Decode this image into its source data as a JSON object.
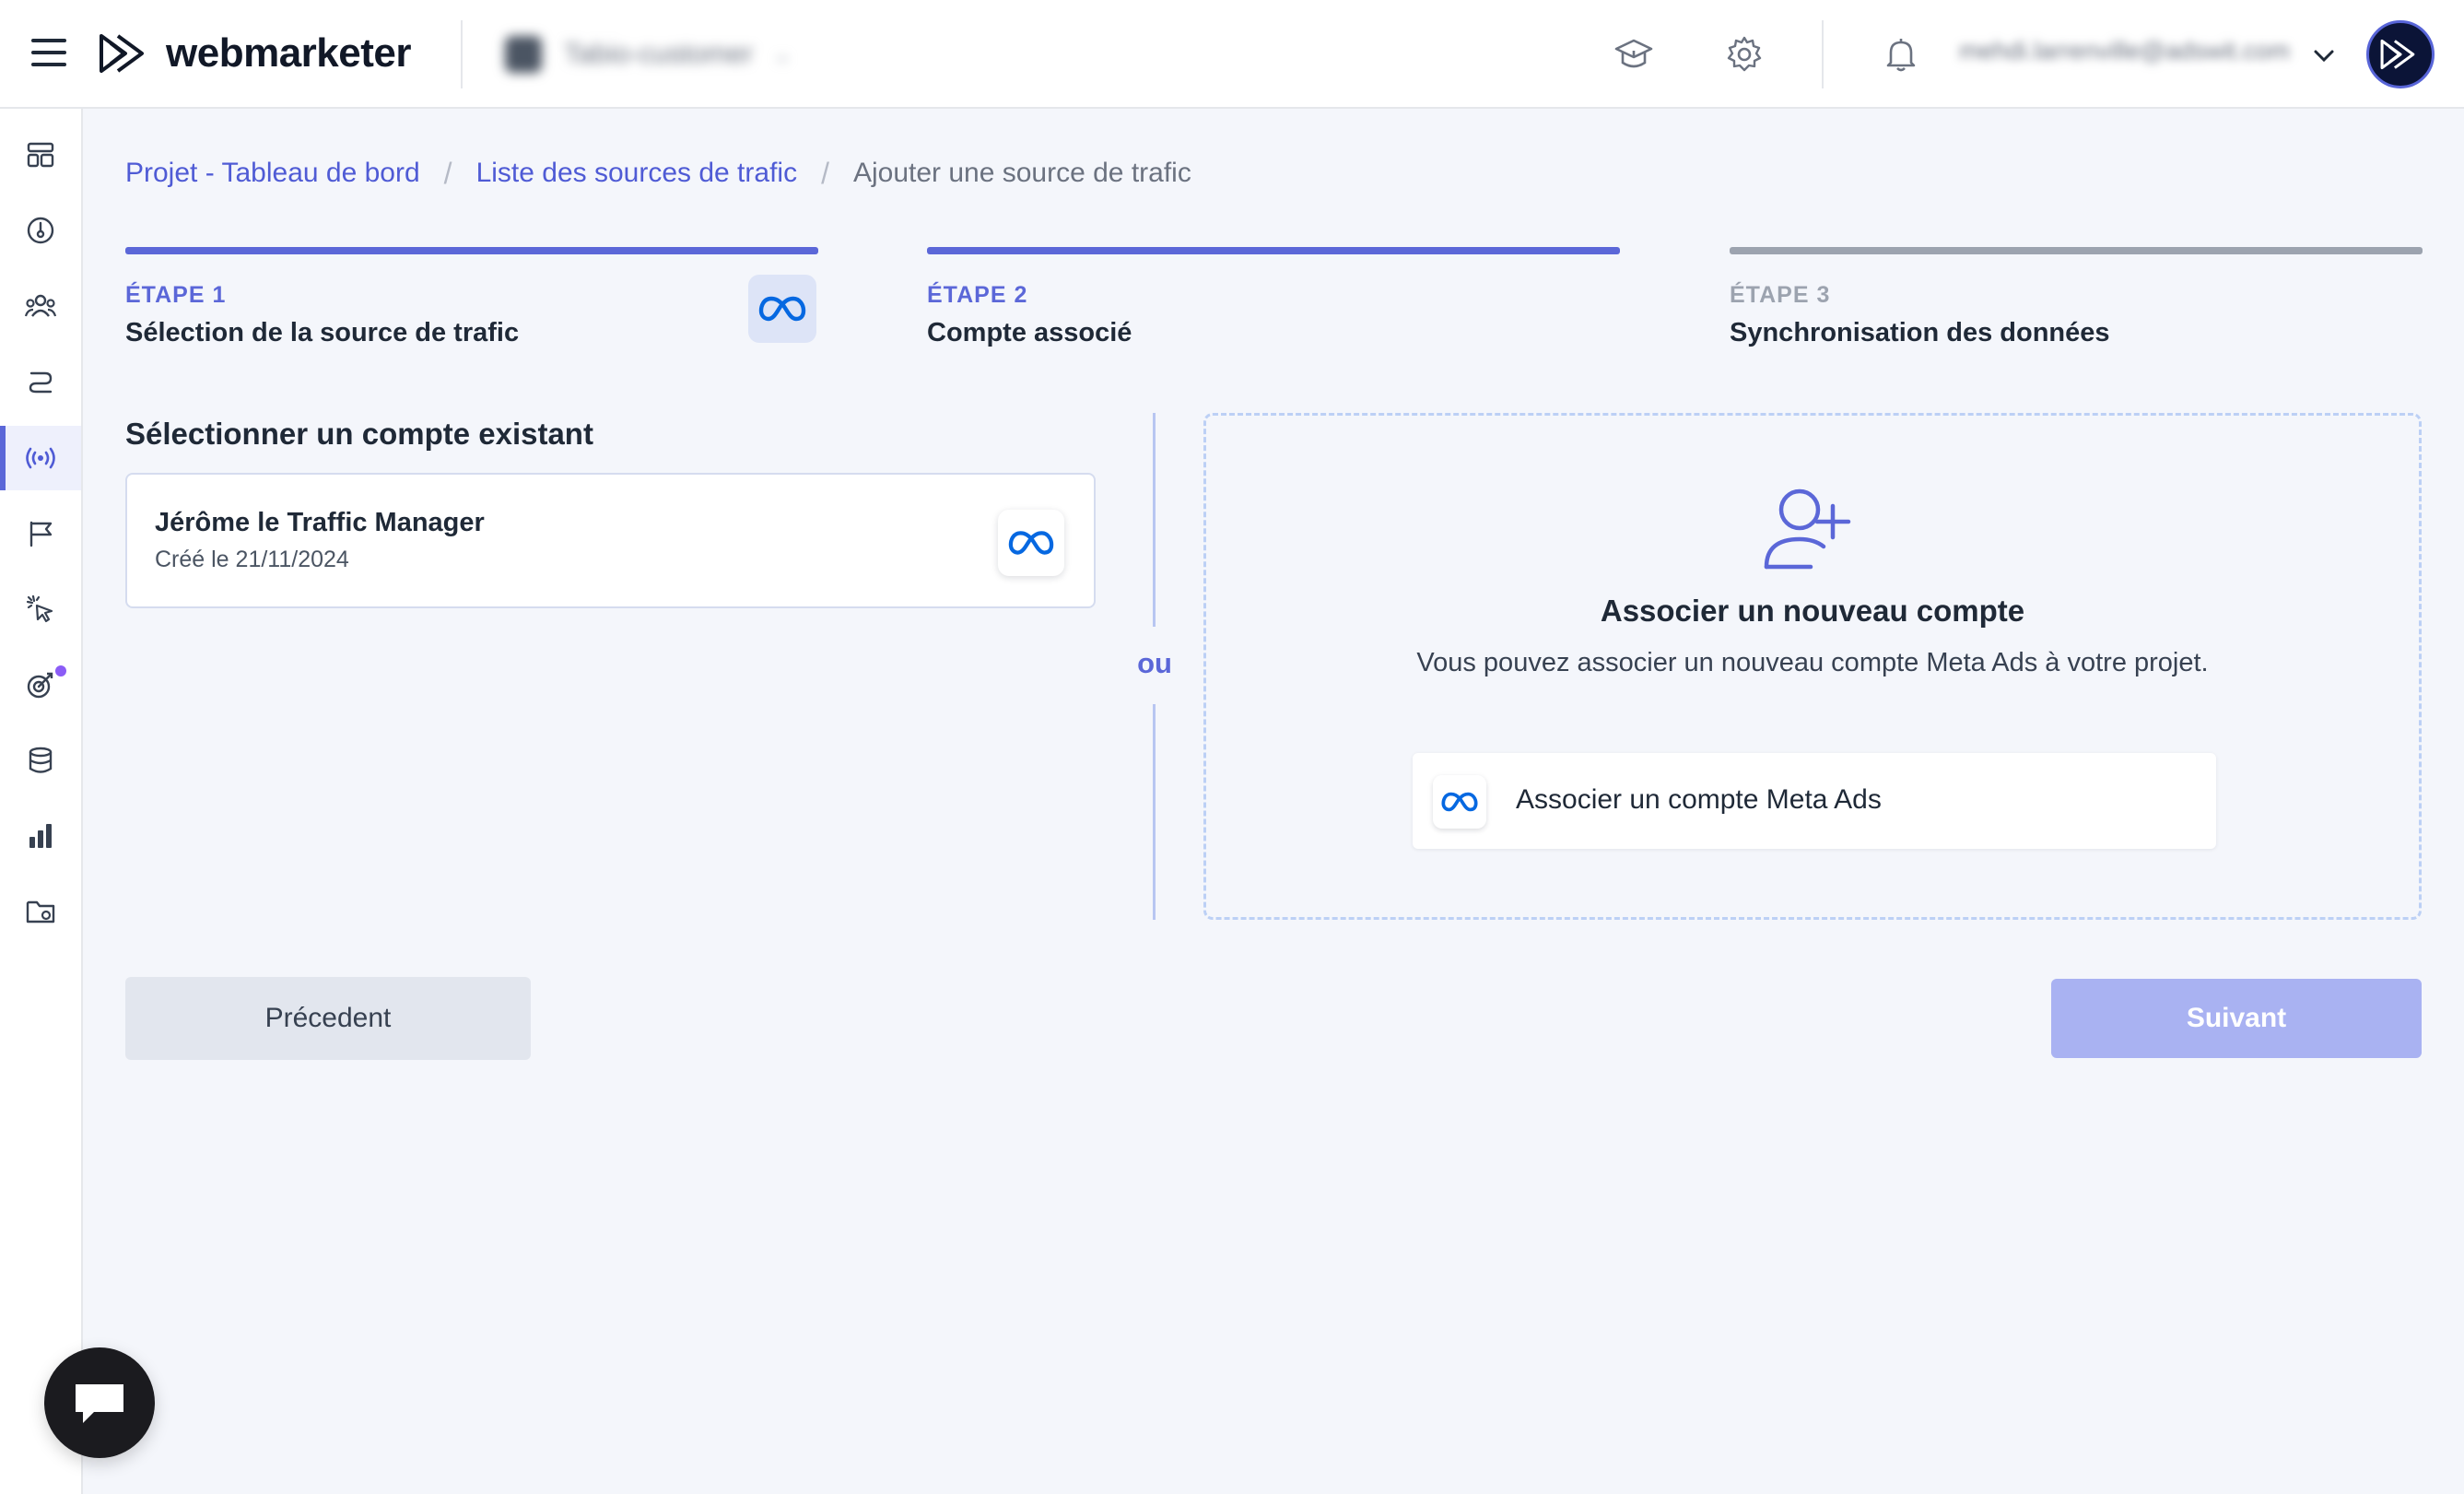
{
  "header": {
    "logo_text": "webmarketer",
    "project_name": "Tabio-customer",
    "user_email": "mehdi.larrenville@adswit.com",
    "icons": [
      "menu-icon",
      "academy-icon",
      "gear-icon",
      "bell-icon",
      "chevron-down-icon",
      "brand-avatar"
    ]
  },
  "sidebar": {
    "items": [
      {
        "icon": "dashboard-icon",
        "active": false
      },
      {
        "icon": "gauge-icon",
        "active": false
      },
      {
        "icon": "users-icon",
        "active": false
      },
      {
        "icon": "route-icon",
        "active": false
      },
      {
        "icon": "broadcast-icon",
        "active": true
      },
      {
        "icon": "flag-icon",
        "active": false
      },
      {
        "icon": "cursor-click-icon",
        "active": false
      },
      {
        "icon": "target-icon",
        "active": false,
        "badge": true
      },
      {
        "icon": "database-icon",
        "active": false
      },
      {
        "icon": "bar-chart-icon",
        "active": false
      },
      {
        "icon": "folder-icon",
        "active": false
      }
    ]
  },
  "breadcrumb": {
    "items": [
      "Projet - Tableau de bord",
      "Liste des sources de trafic"
    ],
    "separator": "/",
    "current": "Ajouter une source de trafic"
  },
  "steps": [
    {
      "label": "ÉTAPE 1",
      "title": "Sélection de la source de trafic",
      "state": "done",
      "color": "#5b67d8"
    },
    {
      "label": "ÉTAPE 2",
      "title": "Compte associé",
      "state": "active",
      "color": "#5b67d8"
    },
    {
      "label": "ÉTAPE 3",
      "title": "Synchronisation des données",
      "state": "pending",
      "color": "#9ca3af"
    }
  ],
  "existing": {
    "title": "Sélectionner un compte existant",
    "accounts": [
      {
        "name": "Jérôme le Traffic Manager",
        "created": "Créé le 21/11/2024",
        "icon": "meta-icon"
      }
    ]
  },
  "divider_text": "ou",
  "new_account": {
    "icon": "user-plus-icon",
    "title": "Associer un nouveau compte",
    "description": "Vous pouvez associer un nouveau compte Meta Ads à votre projet.",
    "button_label": "Associer un compte Meta Ads"
  },
  "actions": {
    "previous": "Précedent",
    "next": "Suivant",
    "next_disabled": true
  },
  "colors": {
    "accent": "#5b67d8",
    "meta_blue": "#0668e1",
    "background": "#f4f6fb"
  }
}
